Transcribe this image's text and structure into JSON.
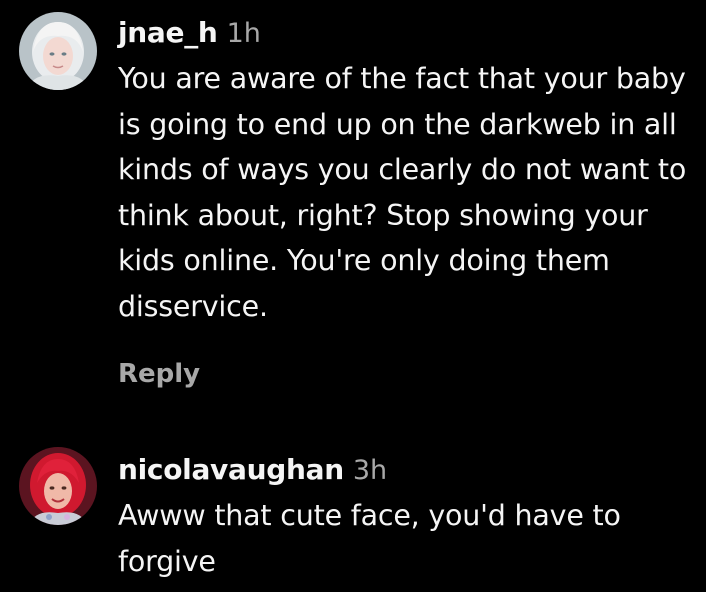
{
  "comments": [
    {
      "username": "jnae_h",
      "time": "1h",
      "text": "You are aware of the fact that your baby is going to end up on the darkweb in all kinds of ways you clearly do not want to think about, right? Stop showing your kids online. You're only doing them disservice.",
      "reply_label": "Reply"
    },
    {
      "username": "nicolavaughan",
      "time": "3h",
      "text": "Awww that cute face, you'd have to forgive"
    }
  ]
}
